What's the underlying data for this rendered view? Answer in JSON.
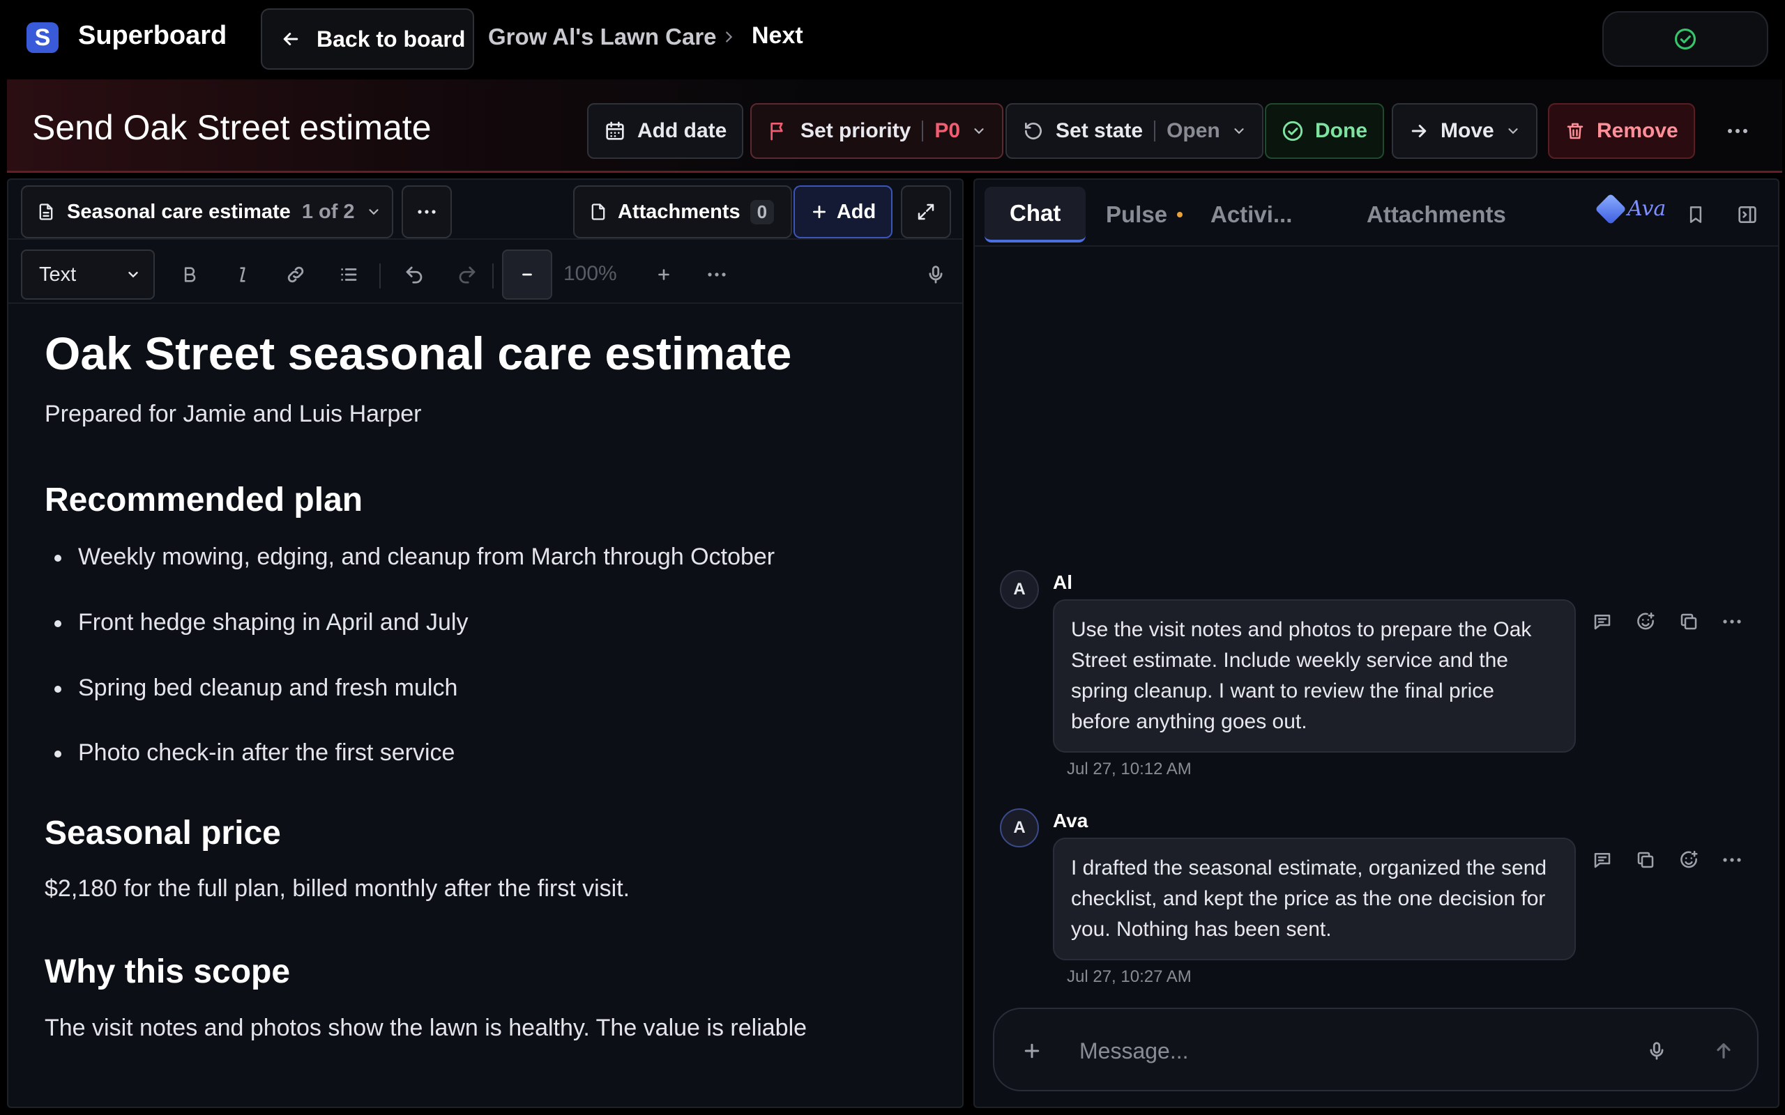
{
  "app": {
    "name": "Superboard",
    "logo_letter": "S"
  },
  "nav": {
    "back_label": "Back to board",
    "breadcrumbs": [
      "Grow Al's Lawn Care",
      "Next"
    ]
  },
  "task": {
    "title": "Send Oak Street estimate",
    "actions": {
      "add_date": "Add date",
      "set_priority": "Set priority",
      "priority_value": "P0",
      "set_state": "Set state",
      "state_value": "Open",
      "done": "Done",
      "move": "Move",
      "remove": "Remove"
    }
  },
  "editor": {
    "doc_name": "Seasonal care estimate",
    "doc_count": "1 of 2",
    "attachments_label": "Attachments",
    "attachments_count": "0",
    "add_label": "Add",
    "format_value": "Text",
    "zoom": "100%",
    "content": {
      "h1": "Oak Street seasonal care estimate",
      "intro": "Prepared for Jamie and Luis Harper",
      "plan_heading": "Recommended plan",
      "plan_items": [
        "Weekly mowing, edging, and cleanup from March through October",
        "Front hedge shaping in April and July",
        "Spring bed cleanup and fresh mulch",
        "Photo check-in after the first service"
      ],
      "price_heading": "Seasonal price",
      "price_text": "$2,180 for the full plan, billed monthly after the first visit.",
      "scope_heading": "Why this scope",
      "scope_text": "The visit notes and photos show the lawn is healthy. The value is reliable"
    }
  },
  "chat": {
    "tabs": [
      "Chat",
      "Pulse",
      "Activi...",
      "Attachments"
    ],
    "assistant_name": "Ava",
    "messages": [
      {
        "avatar": "A",
        "author": "Al",
        "text": "Use the visit notes and photos to prepare the Oak Street estimate. Include weekly service and the spring cleanup. I want to review the final price before anything goes out.",
        "time": "Jul 27, 10:12 AM"
      },
      {
        "avatar": "A",
        "author": "Ava",
        "text": "I drafted the seasonal estimate, organized the send checklist, and kept the price as the one decision for you. Nothing has been sent.",
        "time": "Jul 27, 10:27 AM"
      }
    ],
    "composer_placeholder": "Message..."
  },
  "colors": {
    "accent": "#3a5bd9",
    "priority": "#f25d72",
    "done": "#7ee3a0",
    "remove": "#ff8f98",
    "pulse_dot": "#e9a23b",
    "status_check": "#37c46b"
  }
}
